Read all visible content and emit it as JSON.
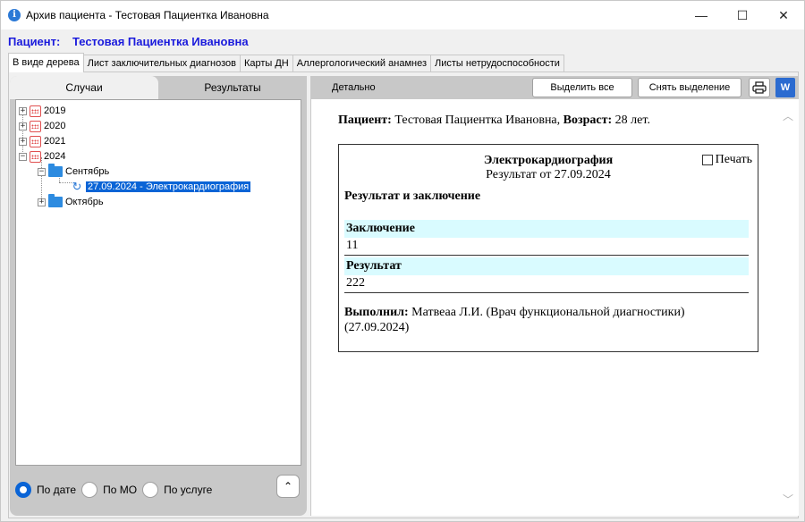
{
  "window": {
    "title": "Архив пациента - Тестовая Пациентка Ивановна",
    "controls": {
      "minimize": "—",
      "maximize": "☐",
      "close": "✕"
    }
  },
  "patient_header": {
    "label": "Пациент:",
    "name": "Тестовая Пациентка Ивановна"
  },
  "tabs": [
    {
      "label": "В виде дерева",
      "active": true
    },
    {
      "label": "Лист заключительных диагнозов",
      "active": false
    },
    {
      "label": "Карты ДН",
      "active": false
    },
    {
      "label": "Аллергологический анамнез",
      "active": false
    },
    {
      "label": "Листы нетрудоспособности",
      "active": false
    }
  ],
  "left_panel": {
    "tabs": [
      {
        "label": "Случаи",
        "active": false
      },
      {
        "label": "Результаты",
        "active": true
      }
    ],
    "tree": [
      {
        "label": "2019",
        "expander": "+",
        "icon": "calendar-icon"
      },
      {
        "label": "2020",
        "expander": "+",
        "icon": "calendar-icon"
      },
      {
        "label": "2021",
        "expander": "+",
        "icon": "calendar-icon"
      },
      {
        "label": "2024",
        "expander": "−",
        "icon": "calendar-icon"
      },
      {
        "label": "Сентябрь",
        "expander": "−",
        "icon": "folder-icon"
      },
      {
        "label": "27.09.2024 - Электрокардиография",
        "icon": "ecg-icon",
        "selected": true
      },
      {
        "label": "Октябрь",
        "expander": "+",
        "icon": "folder-icon"
      }
    ],
    "radio": [
      {
        "label": "По дате",
        "checked": true
      },
      {
        "label": "По МО",
        "checked": false
      },
      {
        "label": "По услуге",
        "checked": false
      }
    ],
    "up_button": "⌃"
  },
  "right_panel": {
    "caption": "Детально",
    "select_all_button": "Выделить все",
    "deselect_button": "Снять выделение",
    "word_button": "W",
    "document": {
      "patient_label": "Пациент:",
      "patient_name": "Тестовая Пациентка Ивановна,",
      "age_label": "Возраст:",
      "age_value": "28 лет.",
      "card": {
        "title": "Электрокардиография",
        "subtitle": "Результат от 27.09.2024",
        "print_label": "Печать",
        "section_heading": "Результат и заключение",
        "fields": [
          {
            "label": "Заключение",
            "value": "11"
          },
          {
            "label": "Результат",
            "value": "222"
          }
        ],
        "performer_label": "Выполнил:",
        "performer_text": "Матвеаа Л.И. (Врач функциональной диагностики) (27.09.2024)"
      }
    }
  },
  "colors": {
    "patient_header": "#1a1adc",
    "selection": "#0a64d6",
    "field_highlight": "#d9fbff",
    "calendar_icon": "#e05050",
    "folder_icon": "#2d8be0"
  }
}
